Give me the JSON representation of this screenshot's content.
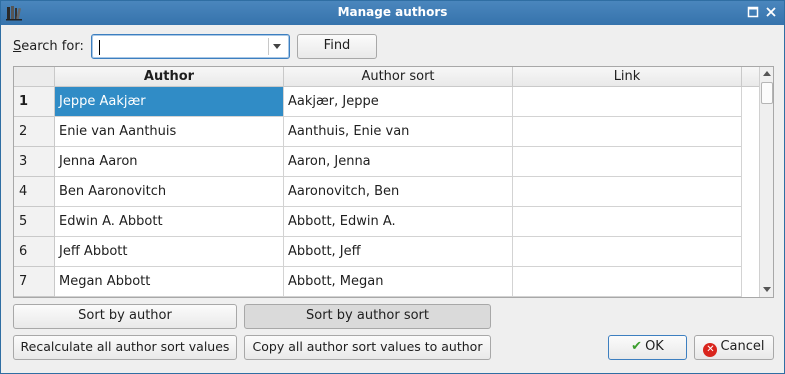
{
  "window": {
    "title": "Manage authors",
    "app_icon": "books-icon",
    "controls": [
      "maximize-icon",
      "close-icon"
    ]
  },
  "search": {
    "label_prefix": "S",
    "label_rest": "earch for:",
    "value": "",
    "placeholder": "",
    "find_button": "Find"
  },
  "table": {
    "columns": [
      "Author",
      "Author sort",
      "Link"
    ],
    "rows": [
      {
        "num": "1",
        "author": "Jeppe Aakjær",
        "sort": "Aakjær, Jeppe",
        "link": ""
      },
      {
        "num": "2",
        "author": "Enie van Aanthuis",
        "sort": "Aanthuis, Enie van",
        "link": ""
      },
      {
        "num": "3",
        "author": "Jenna Aaron",
        "sort": "Aaron, Jenna",
        "link": ""
      },
      {
        "num": "4",
        "author": "Ben Aaronovitch",
        "sort": "Aaronovitch, Ben",
        "link": ""
      },
      {
        "num": "5",
        "author": "Edwin A. Abbott",
        "sort": "Abbott, Edwin A.",
        "link": ""
      },
      {
        "num": "6",
        "author": "Jeff Abbott",
        "sort": "Abbott, Jeff",
        "link": ""
      },
      {
        "num": "7",
        "author": "Megan Abbott",
        "sort": "Abbott, Megan",
        "link": ""
      }
    ]
  },
  "buttons": {
    "sort_by_author": "Sort by author",
    "sort_by_author_sort": "Sort by author sort",
    "recalculate": "Recalculate all author sort values",
    "copy": "Copy all author sort values to author",
    "ok": "OK",
    "cancel": "Cancel"
  },
  "colors": {
    "title_bar": "#3d7ab4",
    "selection": "#308cc6",
    "ok_check": "#3a9d2c",
    "cancel_icon": "#d9251d"
  }
}
